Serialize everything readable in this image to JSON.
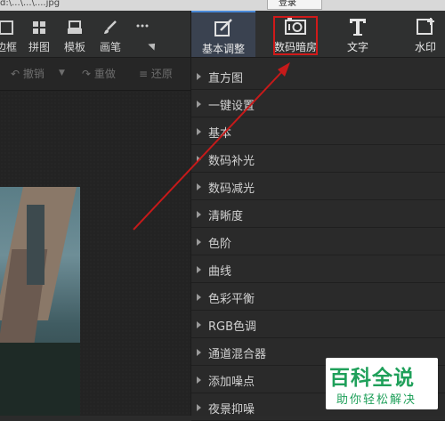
{
  "titlebar": {
    "path_text": "d:\\...\\...\\....jpg",
    "login_label": "登录"
  },
  "toolbar": {
    "tools": [
      {
        "id": "frame",
        "label": "边框",
        "icon": "frame-icon"
      },
      {
        "id": "collage",
        "label": "拼图",
        "icon": "grid-icon"
      },
      {
        "id": "template",
        "label": "模板",
        "icon": "template-icon"
      },
      {
        "id": "brush",
        "label": "画笔",
        "icon": "brush-icon"
      },
      {
        "id": "more",
        "label": "",
        "icon": "more-icon"
      }
    ],
    "tabs": [
      {
        "id": "basic",
        "label": "基本调整",
        "icon": "edit-icon",
        "active": true
      },
      {
        "id": "darkroom",
        "label": "数码暗房",
        "icon": "camera-icon",
        "highlighted": true
      },
      {
        "id": "text",
        "label": "文字",
        "icon": "text-icon"
      },
      {
        "id": "watermark",
        "label": "水印",
        "icon": "watermark-icon"
      }
    ]
  },
  "subbar": {
    "undo": "撤销",
    "redo": "重做",
    "restore": "还原"
  },
  "panel": {
    "items": [
      "直方图",
      "一键设置",
      "基本",
      "数码补光",
      "数码减光",
      "清晰度",
      "色阶",
      "曲线",
      "色彩平衡",
      "RGB色调",
      "通道混合器",
      "添加噪点",
      "夜景抑噪"
    ]
  },
  "watermark_badge": {
    "title": "百科全说",
    "subtitle": "助你轻松解决"
  },
  "colors": {
    "active_tab_bg": "#3a4250",
    "highlight_red": "#d01a1a",
    "watermark_green": "#1fa05a"
  }
}
